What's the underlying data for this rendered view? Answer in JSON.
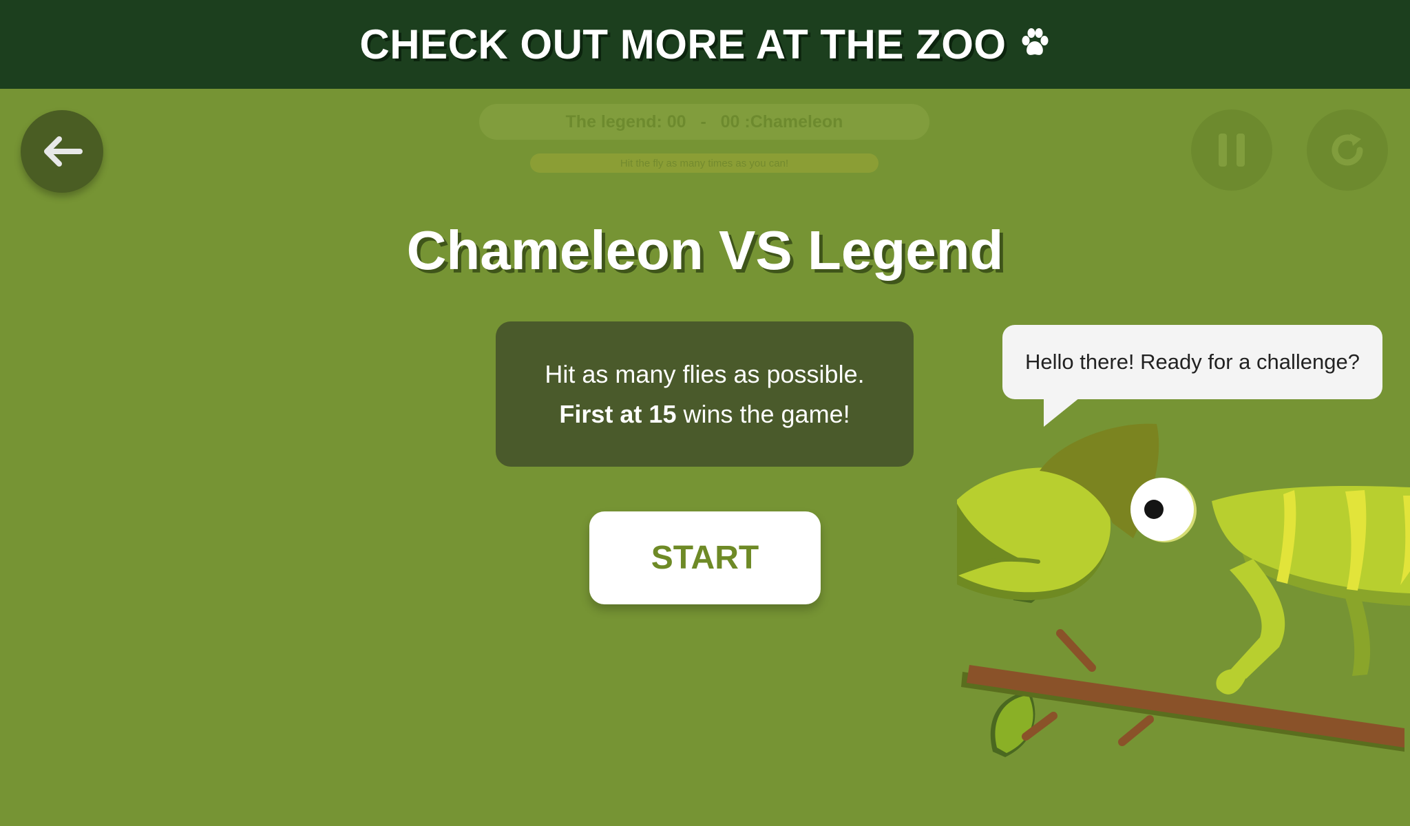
{
  "banner": {
    "text": "CHECK OUT MORE AT THE ZOO",
    "icon": "paw-icon"
  },
  "hud": {
    "score_left_label": "The legend:",
    "score_left_value": "00",
    "separator": "-",
    "score_right_value": "00",
    "score_right_label": ":Chameleon",
    "hint": "Hit the fly as many times as you can!"
  },
  "icons": {
    "back": "arrow-left-icon",
    "pause": "pause-icon",
    "reset": "reset-icon"
  },
  "overlay": {
    "title": "Chameleon VS Legend",
    "instruction_line1": "Hit as many flies as possible.",
    "instruction_bold": "First at 15",
    "instruction_rest": " wins the game!",
    "start_label": "START"
  },
  "bubble": {
    "text": "Hello there! Ready for a challenge?"
  },
  "colors": {
    "background": "#769434",
    "banner": "#1c3f1e",
    "panel": "#4a5a2b",
    "start_text": "#6e8a26",
    "chameleon": "#b8cf2f",
    "branch": "#8a5229"
  }
}
